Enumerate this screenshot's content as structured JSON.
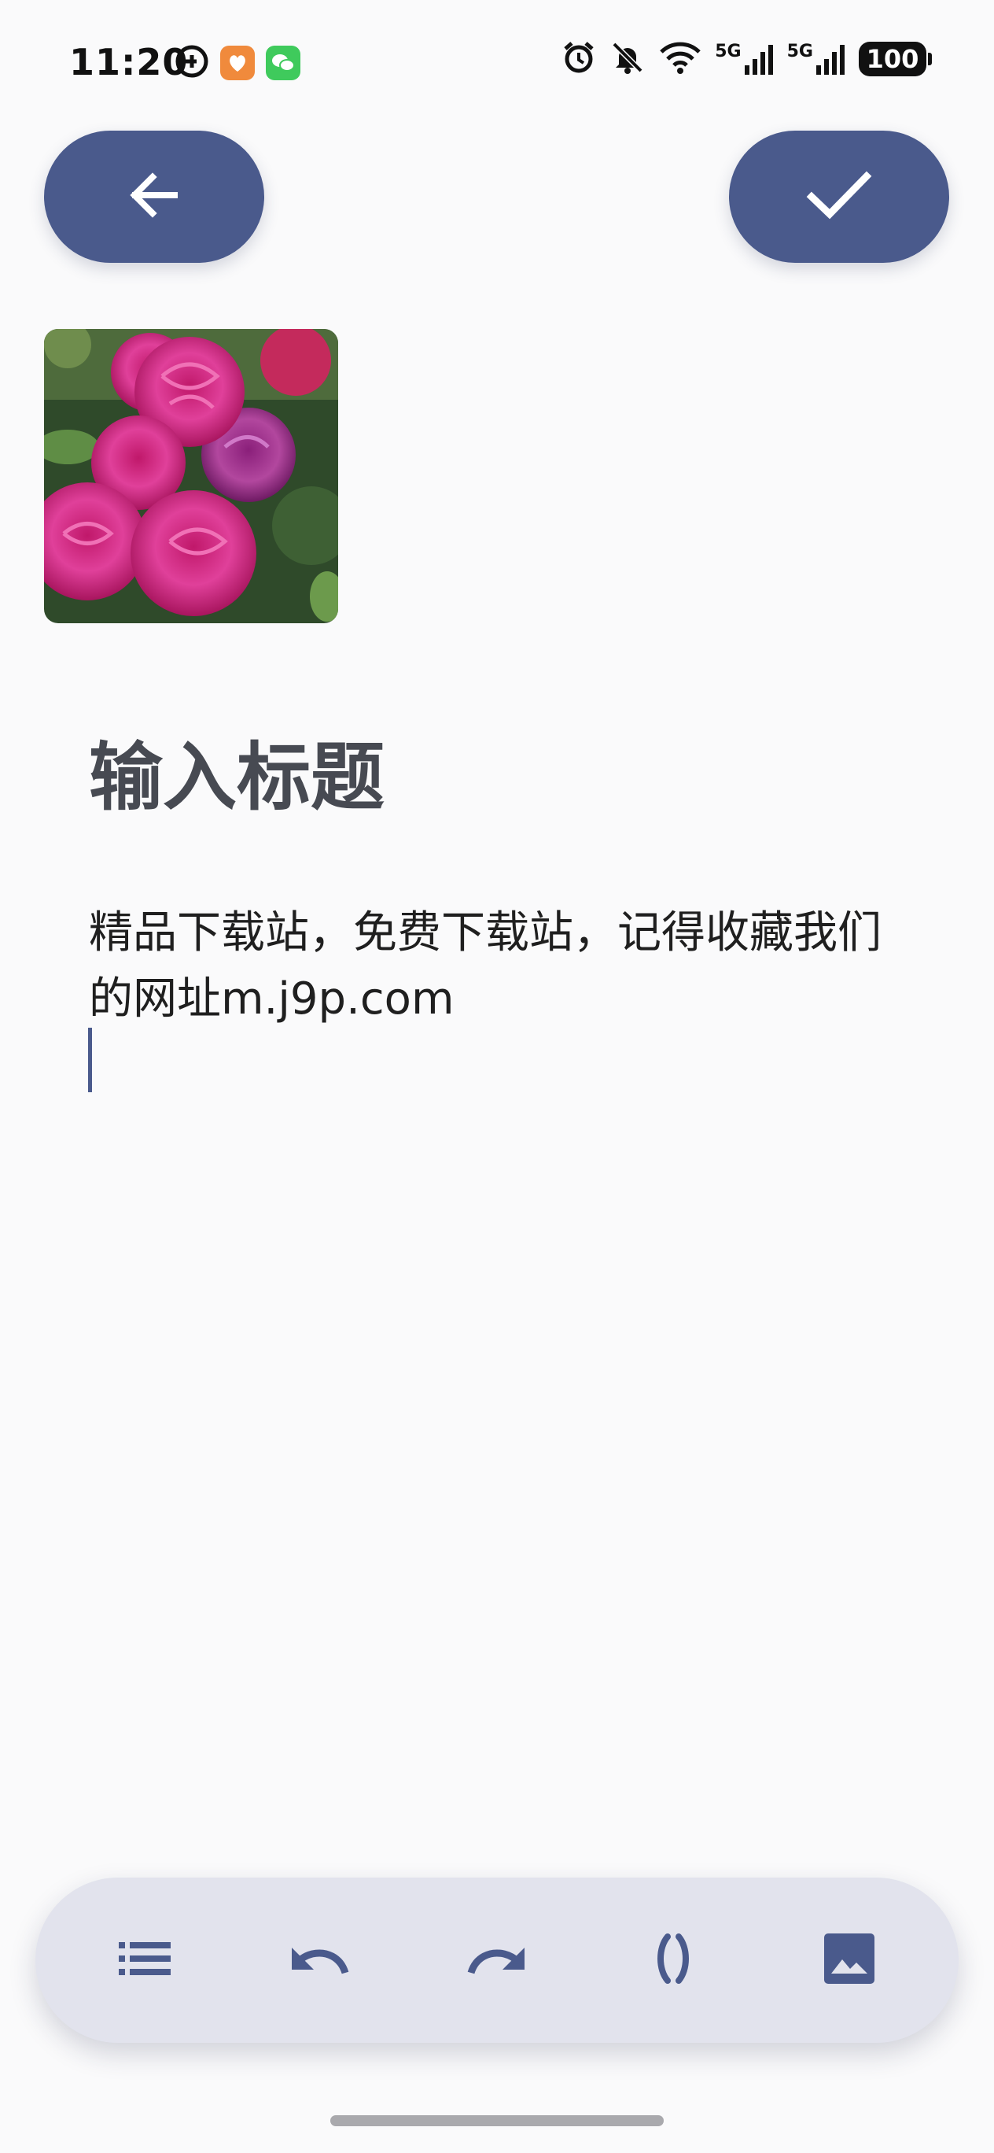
{
  "status_bar": {
    "time": "11:20",
    "network_1": "5G",
    "network_2": "5G",
    "battery": "100"
  },
  "header": {
    "back_icon": "arrow-left-icon",
    "done_icon": "check-icon"
  },
  "attachment": {
    "type": "image",
    "subject": "pink roses"
  },
  "note": {
    "title": "输入标题",
    "body": "精品下载站，免费下载站，记得收藏我们的网址m.j9p.com"
  },
  "toolbar": {
    "items": [
      "list-icon",
      "undo-icon",
      "redo-icon",
      "parentheses-icon",
      "image-icon"
    ]
  },
  "colors": {
    "accent": "#4a5a8c",
    "background": "#fafafb",
    "toolbar_bg": "#e2e3ed",
    "title_text": "#474a52"
  }
}
